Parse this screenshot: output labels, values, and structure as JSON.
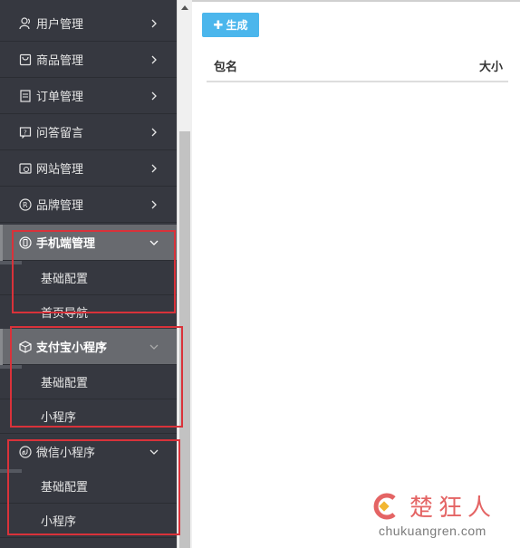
{
  "sidebar": {
    "items": [
      {
        "label": "用户管理",
        "icon": "users-icon"
      },
      {
        "label": "商品管理",
        "icon": "bag-icon"
      },
      {
        "label": "订单管理",
        "icon": "list-icon"
      },
      {
        "label": "问答留言",
        "icon": "message-icon"
      },
      {
        "label": "网站管理",
        "icon": "website-icon"
      },
      {
        "label": "品牌管理",
        "icon": "registered-icon"
      },
      {
        "label": "手机端管理",
        "icon": "mobile-icon",
        "expanded": true,
        "children": [
          "基础配置",
          "首页导航"
        ]
      },
      {
        "label": "支付宝小程序",
        "icon": "cube-icon",
        "expanded": true,
        "children": [
          "基础配置",
          "小程序"
        ]
      },
      {
        "label": "微信小程序",
        "icon": "wechat-icon",
        "expanded": true,
        "children": [
          "基础配置",
          "小程序"
        ]
      }
    ]
  },
  "main": {
    "generate_button": "生成",
    "table": {
      "columns": [
        "包名",
        "大小"
      ]
    }
  },
  "watermark": {
    "name": "楚狂人",
    "url": "chukuangren.com"
  },
  "colors": {
    "sidebar": "#363840",
    "accent": "#4bb6ec",
    "highlight": "#d9323a"
  }
}
